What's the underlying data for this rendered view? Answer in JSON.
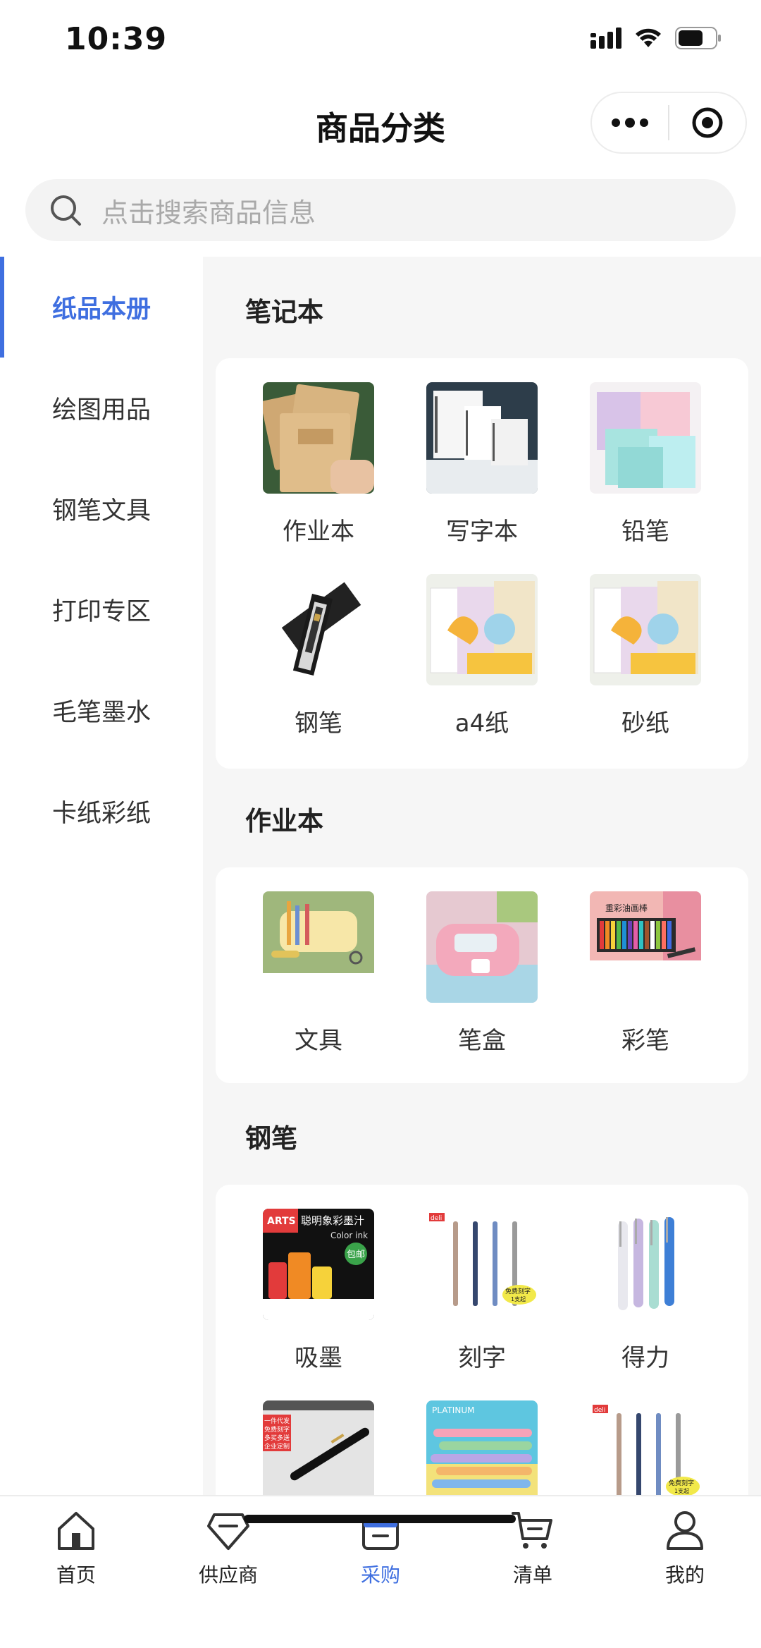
{
  "status_bar": {
    "time": "10:39"
  },
  "header": {
    "title": "商品分类"
  },
  "search": {
    "placeholder": "点击搜索商品信息"
  },
  "sidebar": {
    "items": [
      {
        "label": "纸品本册",
        "active": true
      },
      {
        "label": "绘图用品",
        "active": false
      },
      {
        "label": "钢笔文具",
        "active": false
      },
      {
        "label": "打印专区",
        "active": false
      },
      {
        "label": "毛笔墨水",
        "active": false
      },
      {
        "label": "卡纸彩纸",
        "active": false
      }
    ]
  },
  "sections": [
    {
      "title": "笔记本",
      "items": [
        {
          "label": "作业本",
          "icon": "notebook-image"
        },
        {
          "label": "写字本",
          "icon": "spiral-notebook-image"
        },
        {
          "label": "铅笔",
          "icon": "pastel-booklets-image"
        },
        {
          "label": "钢笔",
          "icon": "fountain-pen-box-image"
        },
        {
          "label": "a4纸",
          "icon": "paper-pack-image"
        },
        {
          "label": "砂纸",
          "icon": "paper-pack-image"
        }
      ]
    },
    {
      "title": "作业本",
      "items": [
        {
          "label": "文具",
          "icon": "stationery-set-image"
        },
        {
          "label": "笔盒",
          "icon": "pencil-case-image"
        },
        {
          "label": "彩笔",
          "icon": "color-markers-image"
        }
      ]
    },
    {
      "title": "钢笔",
      "items": [
        {
          "label": "吸墨",
          "icon": "color-ink-image"
        },
        {
          "label": "刻字",
          "icon": "gel-pens-image"
        },
        {
          "label": "得力",
          "icon": "pastel-pens-image"
        },
        {
          "label": "",
          "icon": "black-pen-image"
        },
        {
          "label": "",
          "icon": "platinum-pens-image"
        },
        {
          "label": "",
          "icon": "gel-pens-image"
        }
      ]
    }
  ],
  "thumb_texts": {
    "color_ink_title": "聪明象彩墨汁",
    "color_ink_sub": "Color ink",
    "color_ink_badge": "包邮",
    "platinum": "PLATINUM",
    "deli": "deli",
    "engrave_tag": "免费刻字",
    "engrave_tag2": "1支起",
    "promo_1": "一件代发",
    "promo_2": "免费刻字",
    "promo_3": "多买多送",
    "promo_4": "企业定制",
    "oil_pastel": "重彩油画棒",
    "art_badge": "ARTS"
  },
  "tabbar": {
    "items": [
      {
        "label": "首页",
        "icon": "home-icon",
        "active": false
      },
      {
        "label": "供应商",
        "icon": "diamond-icon",
        "active": false
      },
      {
        "label": "采购",
        "icon": "store-icon",
        "active": true
      },
      {
        "label": "清单",
        "icon": "cart-icon",
        "active": false
      },
      {
        "label": "我的",
        "icon": "user-icon",
        "active": false
      }
    ]
  },
  "colors": {
    "accent": "#3f6fe0",
    "background": "#f6f6f6",
    "card": "#ffffff",
    "text": "#222222",
    "placeholder": "#a9a9a9"
  }
}
